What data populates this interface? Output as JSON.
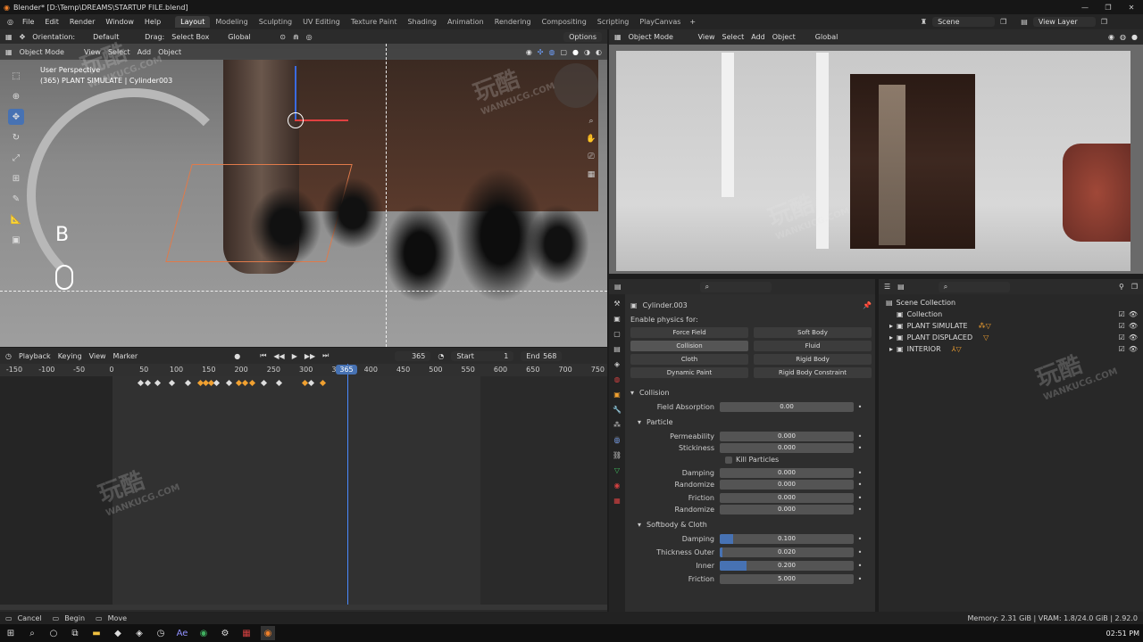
{
  "window": {
    "title": "Blender* [D:\\Temp\\DREAMS\\STARTUP FILE.blend]"
  },
  "menus": [
    "File",
    "Edit",
    "Render",
    "Window",
    "Help"
  ],
  "workspaces": [
    "Layout",
    "Modeling",
    "Sculpting",
    "UV Editing",
    "Texture Paint",
    "Shading",
    "Animation",
    "Rendering",
    "Compositing",
    "Scripting",
    "PlayCanvas"
  ],
  "active_workspace": "Layout",
  "scene": {
    "name": "Scene",
    "view_layer": "View Layer"
  },
  "tool_header": {
    "orientation_label": "Orientation:",
    "orientation_value": "Default",
    "drag_label": "Drag:",
    "drag_value": "Select Box",
    "transform": "Global",
    "options": "Options"
  },
  "viewport_left": {
    "mode": "Object Mode",
    "menus": [
      "View",
      "Select",
      "Add",
      "Object"
    ],
    "perspective": "User Perspective",
    "object_info": "(365) PLANT SIMULATE | Cylinder003",
    "key_overlay": "B"
  },
  "viewport_right": {
    "mode": "Object Mode",
    "menus": [
      "View",
      "Select",
      "Add",
      "Object"
    ],
    "transform": "Global"
  },
  "timeline": {
    "menus": [
      "Playback",
      "Keying",
      "View",
      "Marker"
    ],
    "current_frame": "365",
    "start_label": "Start",
    "start": "1",
    "end_label": "End",
    "end": "568",
    "ruler": [
      "-150",
      "-100",
      "-50",
      "0",
      "50",
      "100",
      "150",
      "200",
      "250",
      "300",
      "350",
      "400",
      "450",
      "500",
      "550",
      "600",
      "650",
      "700",
      "750"
    ],
    "playhead": "365"
  },
  "properties": {
    "object": "Cylinder.003",
    "enable_physics": "Enable physics for:",
    "physics_buttons": [
      "Force Field",
      "Soft Body",
      "Collision",
      "Fluid",
      "Cloth",
      "Rigid Body",
      "Dynamic Paint",
      "Rigid Body Constraint"
    ],
    "collision_panel": "Collision",
    "field_absorption": {
      "label": "Field Absorption",
      "value": "0.00"
    },
    "particle_panel": "Particle",
    "permeability": {
      "label": "Permeability",
      "value": "0.000"
    },
    "stickiness": {
      "label": "Stickiness",
      "value": "0.000"
    },
    "kill_particles": "Kill Particles",
    "damping": {
      "label": "Damping",
      "value": "0.000"
    },
    "randomize": {
      "label": "Randomize",
      "value": "0.000"
    },
    "friction": {
      "label": "Friction",
      "value": "0.000"
    },
    "randomize2": {
      "label": "Randomize",
      "value": "0.000"
    },
    "softbody_panel": "Softbody & Cloth",
    "sb_damping": {
      "label": "Damping",
      "value": "0.100",
      "fill": 0.1
    },
    "thickness_outer": {
      "label": "Thickness Outer",
      "value": "0.020",
      "fill": 0.02
    },
    "inner": {
      "label": "Inner",
      "value": "0.200",
      "fill": 0.2
    },
    "sb_friction": {
      "label": "Friction",
      "value": "5.000",
      "fill": 0.0
    }
  },
  "outliner": {
    "root": "Scene Collection",
    "items": [
      "Collection",
      "PLANT SIMULATE",
      "PLANT DISPLACED",
      "INTERIOR"
    ]
  },
  "status_bar": {
    "cancel": "Cancel",
    "begin": "Begin",
    "move": "Move",
    "memory": "Memory: 2.31 GiB | VRAM: 1.8/24.0 GiB | 2.92.0"
  },
  "taskbar": {
    "clock": "02:51 PM"
  },
  "watermark": {
    "text": "玩酷",
    "sub": "WANKUCG.COM"
  },
  "colors": {
    "accent": "#4772b3",
    "selected_key": "#f0a030",
    "background": "#1d1d1d"
  }
}
